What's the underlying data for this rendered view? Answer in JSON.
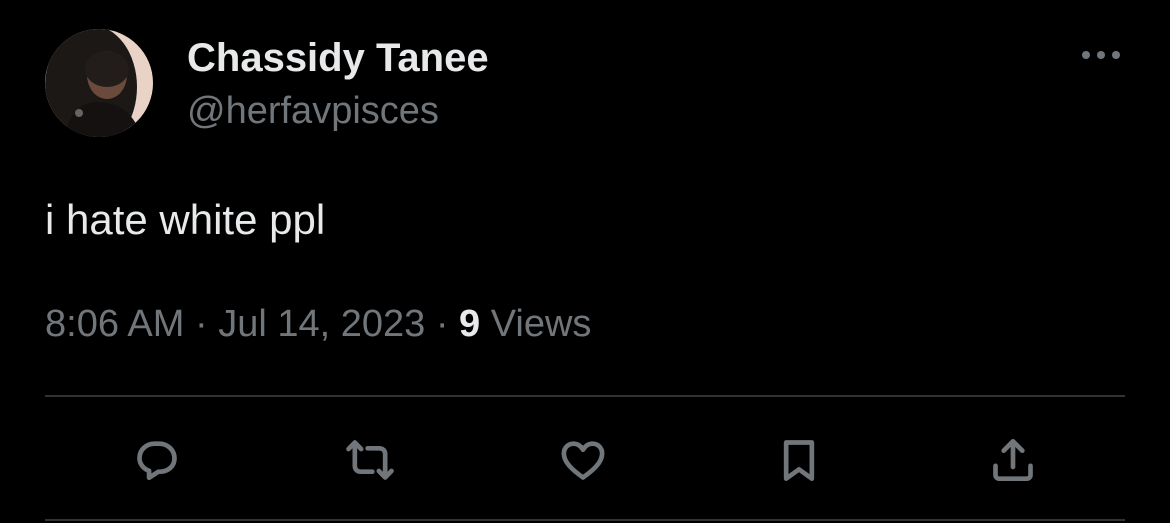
{
  "author": {
    "display_name": "Chassidy Tanee",
    "handle": "@herfavpisces",
    "avatar": "profile-photo"
  },
  "tweet": {
    "text": "i hate white ppl",
    "time": "8:06 AM",
    "separator": "·",
    "date": "Jul 14, 2023",
    "views_count": "9",
    "views_label": "Views"
  },
  "actions": [
    {
      "name": "reply",
      "icon": "reply-bubble-icon"
    },
    {
      "name": "retweet",
      "icon": "retweet-arrows-icon"
    },
    {
      "name": "like",
      "icon": "heart-icon"
    },
    {
      "name": "bookmark",
      "icon": "bookmark-icon"
    },
    {
      "name": "share",
      "icon": "share-upload-icon"
    }
  ],
  "colors": {
    "background": "#000000",
    "primary_text": "#e7e9ea",
    "secondary_text": "#71767b",
    "divider": "#2f3336"
  }
}
